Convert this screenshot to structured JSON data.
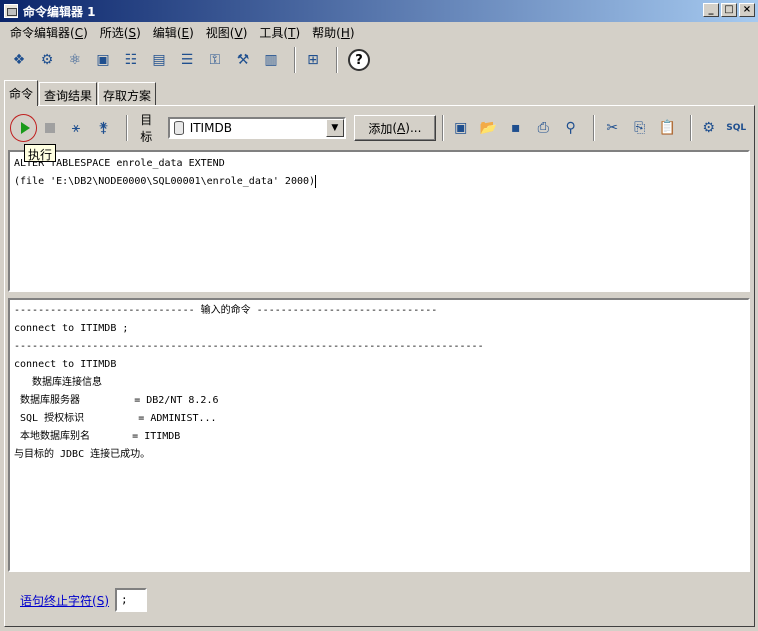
{
  "window": {
    "title": "命令编辑器 1",
    "controls": [
      "_",
      "□",
      "×"
    ]
  },
  "menu": [
    {
      "label": "命令编辑器",
      "key": "C"
    },
    {
      "label": "所选",
      "key": "S"
    },
    {
      "label": "编辑",
      "key": "E"
    },
    {
      "label": "视图",
      "key": "V"
    },
    {
      "label": "工具",
      "key": "T"
    },
    {
      "label": "帮助",
      "key": "H"
    }
  ],
  "toolbar_icons": [
    "control-center-icon",
    "replication-center-icon",
    "satellite-admin-icon",
    "command-editor-icon",
    "task-center-icon",
    "health-center-icon",
    "journal-icon",
    "license-center-icon",
    "development-center-icon",
    "configuration-assistant-icon",
    "custom-control-icon",
    "help-icon"
  ],
  "tabs": [
    "命令",
    "查询结果",
    "存取方案"
  ],
  "command_toolbar": {
    "target_label": "目标",
    "target_value": "ITIMDB",
    "add_label": "添加",
    "add_key": "A",
    "add_suffix": "...",
    "run_tooltip": "执行"
  },
  "editor": {
    "lines": [
      "ALTER TABLESPACE enrole_data EXTEND",
      "(file 'E:\\DB2\\NODE0000\\SQL00001\\enrole_data' 2000)"
    ]
  },
  "output": {
    "lines": [
      "------------------------------ 输入的命令 ------------------------------",
      "connect to ITIMDB ;",
      "------------------------------------------------------------------------------",
      "",
      "connect to ITIMDB",
      "",
      "   数据库连接信息",
      "",
      " 数据库服务器         = DB2/NT 8.2.6",
      " SQL 授权标识         = ADMINIST...",
      " 本地数据库别名       = ITIMDB",
      "",
      "",
      "与目标的 JDBC 连接已成功。"
    ]
  },
  "statement_terminator": {
    "label": "语句终止字符",
    "key": "S",
    "value": ";"
  }
}
